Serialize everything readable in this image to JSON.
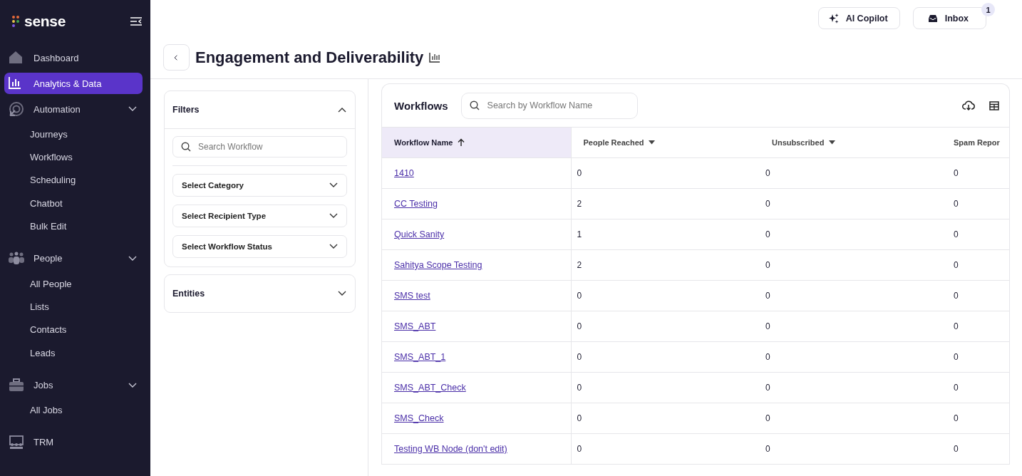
{
  "sidebar": {
    "logo": "sense",
    "items": [
      {
        "kind": "link",
        "label": "Dashboard",
        "selected": false
      },
      {
        "kind": "link",
        "label": "Analytics & Data",
        "selected": true
      },
      {
        "kind": "section",
        "label": "Automation",
        "expanded": true,
        "children": [
          {
            "label": "Journeys"
          },
          {
            "label": "Workflows"
          },
          {
            "label": "Scheduling"
          },
          {
            "label": "Chatbot"
          },
          {
            "label": "Bulk Edit"
          }
        ]
      },
      {
        "kind": "section",
        "label": "People",
        "expanded": true,
        "children": [
          {
            "label": "All People"
          },
          {
            "label": "Lists"
          },
          {
            "label": "Contacts"
          },
          {
            "label": "Leads"
          }
        ]
      },
      {
        "kind": "section",
        "label": "Jobs",
        "expanded": true,
        "children": [
          {
            "label": "All Jobs"
          }
        ]
      },
      {
        "kind": "link",
        "label": "TRM",
        "selected": false
      }
    ]
  },
  "topbar": {
    "copilot": "AI Copilot",
    "inbox": "Inbox",
    "inbox_badge": "1"
  },
  "page": {
    "title": "Engagement and Deliverability"
  },
  "filters": {
    "title": "Filters",
    "expanded": true,
    "search_placeholder": "Search Workflow",
    "selects": [
      "Select Category",
      "Select Recipient Type",
      "Select Workflow Status"
    ]
  },
  "entities": {
    "title": "Entities",
    "expanded": false
  },
  "table": {
    "title": "Workflows",
    "search_placeholder": "Search by Workflow Name",
    "columns": [
      {
        "label": "Workflow Name",
        "kind": "sorted"
      },
      {
        "label": "People Reached",
        "kind": "menu"
      },
      {
        "label": "Unsubscribed",
        "kind": "menu"
      },
      {
        "label": "Spam Repor",
        "kind": "plain"
      }
    ],
    "rows": [
      [
        "1410",
        "0",
        "0",
        "0"
      ],
      [
        "CC Testing",
        "2",
        "0",
        "0"
      ],
      [
        "Quick Sanity",
        "1",
        "0",
        "0"
      ],
      [
        "Sahitya Scope Testing",
        "2",
        "0",
        "0"
      ],
      [
        "SMS test",
        "0",
        "0",
        "0"
      ],
      [
        "SMS_ABT",
        "0",
        "0",
        "0"
      ],
      [
        "SMS_ABT_1",
        "0",
        "0",
        "0"
      ],
      [
        "SMS_ABT_Check",
        "0",
        "0",
        "0"
      ],
      [
        "SMS_Check",
        "0",
        "0",
        "0"
      ],
      [
        "Testing WB Node (don't edit)",
        "0",
        "0",
        "0"
      ]
    ]
  }
}
